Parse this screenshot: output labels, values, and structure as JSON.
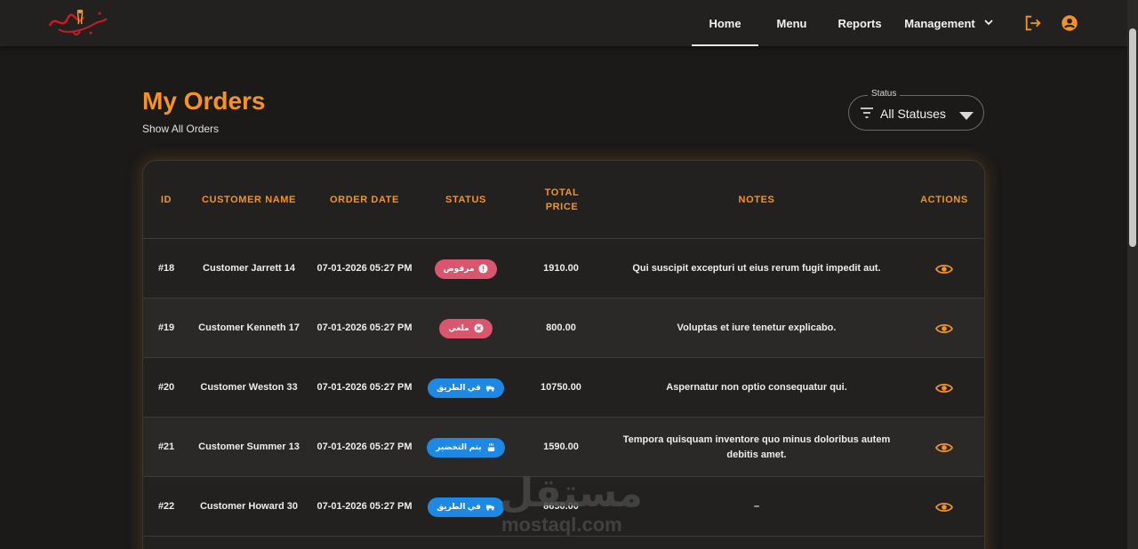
{
  "brand": {
    "logo_text": "منابع الفطر"
  },
  "nav": {
    "items": [
      {
        "label": "Home",
        "active": true
      },
      {
        "label": "Menu",
        "active": false
      },
      {
        "label": "Reports",
        "active": false
      },
      {
        "label": "Management",
        "active": false,
        "has_dropdown": true
      }
    ],
    "icons": [
      "logout-icon",
      "account-circle-icon"
    ],
    "accent_color": "#f7931e"
  },
  "header": {
    "title": "My Orders",
    "subtitle": "Show All Orders"
  },
  "filter": {
    "legend": "Status",
    "value": "All Statuses",
    "icon": "filter-list-icon"
  },
  "table": {
    "columns": {
      "id": "ID",
      "customer_name": "CUSTOMER NAME",
      "order_date": "ORDER DATE",
      "status": "STATUS",
      "total_price": "TOTAL PRICE",
      "notes": "NOTES",
      "actions": "ACTIONS"
    },
    "rows": [
      {
        "id": "#18",
        "customer": "Customer Jarrett 14",
        "date": "07-01-2026 05:27 PM",
        "status": "مرفوض",
        "status_color": "#d9566e",
        "status_icon": "error-icon",
        "total": "1910.00",
        "notes": "Qui suscipit excepturi ut eius rerum fugit impedit aut."
      },
      {
        "id": "#19",
        "customer": "Customer Kenneth 17",
        "date": "07-01-2026 05:27 PM",
        "status": "ملغي",
        "status_color": "#d9566e",
        "status_icon": "cancel-icon",
        "total": "800.00",
        "notes": "Voluptas et iure tenetur explicabo."
      },
      {
        "id": "#20",
        "customer": "Customer Weston 33",
        "date": "07-01-2026 05:27 PM",
        "status": "في الطريق",
        "status_color": "#1e88e5",
        "status_icon": "delivery-icon",
        "total": "10750.00",
        "notes": "Aspernatur non optio consequatur qui."
      },
      {
        "id": "#21",
        "customer": "Customer Summer 13",
        "date": "07-01-2026 05:27 PM",
        "status": "يتم التحضير",
        "status_color": "#1e88e5",
        "status_icon": "cooking-icon",
        "total": "1590.00",
        "notes": "Tempora quisquam inventore quo minus doloribus autem debitis amet."
      },
      {
        "id": "#22",
        "customer": "Customer Howard 30",
        "date": "07-01-2026 05:27 PM",
        "status": "في الطريق",
        "status_color": "#1e88e5",
        "status_icon": "delivery-icon",
        "total": "8650.00",
        "notes": "–"
      }
    ]
  },
  "watermark": {
    "arabic": "مستقل",
    "latin": "mostaql.com"
  }
}
